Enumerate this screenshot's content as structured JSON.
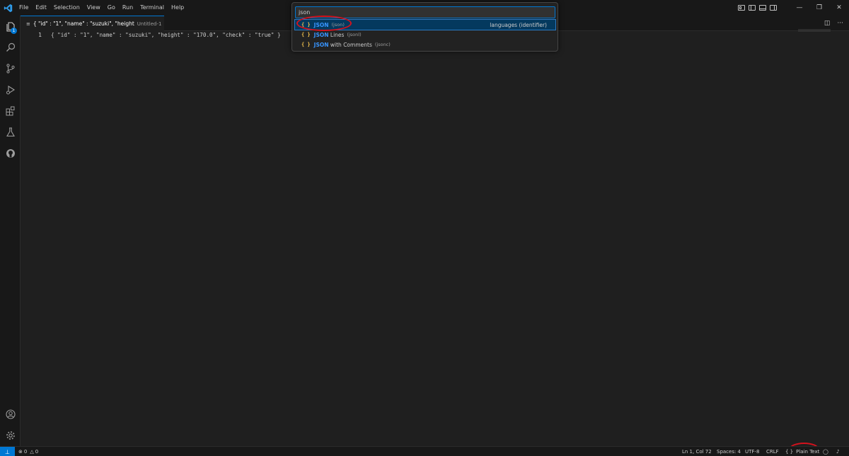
{
  "menu": [
    "File",
    "Edit",
    "Selection",
    "View",
    "Go",
    "Run",
    "Terminal",
    "Help"
  ],
  "activity": {
    "explorer_badge": "1"
  },
  "tab": {
    "title": "{ \"id\" : \"1\", \"name\" : \"suzuki\", \"height",
    "description": "Untitled-1"
  },
  "editor": {
    "line_number": "1",
    "line_text": "{ \"id\" : \"1\", \"name\" : \"suzuki\", \"height\" : \"170.0\", \"check\" : \"true\" }"
  },
  "quickpick": {
    "input_value": "json",
    "items": [
      {
        "name_highlight": "JSON",
        "name_rest": "",
        "id": "(json)",
        "description": "languages (identifier)"
      },
      {
        "name_highlight": "JSON",
        "name_rest": " Lines",
        "id": "(jsonl)",
        "description": ""
      },
      {
        "name_highlight": "JSON",
        "name_rest": " with Comments",
        "id": "(jsonc)",
        "description": ""
      }
    ],
    "item_icon": "{ }"
  },
  "statusbar": {
    "errors": "0",
    "warnings": "0",
    "position": "Ln 1, Col 72",
    "spaces": "Spaces: 4",
    "encoding": "UTF-8",
    "eol": "CRLF",
    "language_icon": "{ }",
    "language": "Plain Text"
  },
  "colors": {
    "accent": "#0078d4",
    "annotation": "#d4121d",
    "json_icon": "#f5c44e",
    "highlight": "#3794ff"
  }
}
